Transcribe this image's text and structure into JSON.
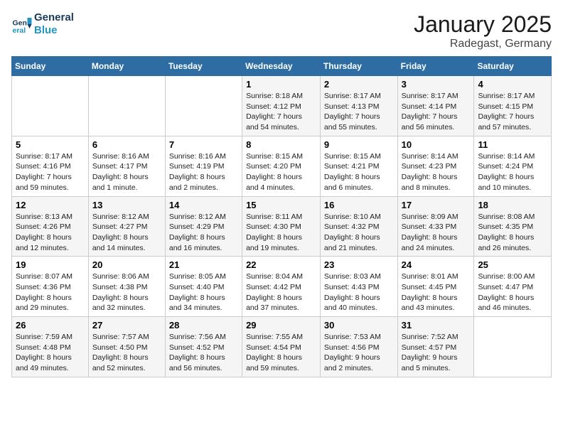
{
  "header": {
    "logo_line1": "General",
    "logo_line2": "Blue",
    "title": "January 2025",
    "subtitle": "Radegast, Germany"
  },
  "days_of_week": [
    "Sunday",
    "Monday",
    "Tuesday",
    "Wednesday",
    "Thursday",
    "Friday",
    "Saturday"
  ],
  "weeks": [
    [
      {
        "day": "",
        "info": ""
      },
      {
        "day": "",
        "info": ""
      },
      {
        "day": "",
        "info": ""
      },
      {
        "day": "1",
        "info": "Sunrise: 8:18 AM\nSunset: 4:12 PM\nDaylight: 7 hours\nand 54 minutes."
      },
      {
        "day": "2",
        "info": "Sunrise: 8:17 AM\nSunset: 4:13 PM\nDaylight: 7 hours\nand 55 minutes."
      },
      {
        "day": "3",
        "info": "Sunrise: 8:17 AM\nSunset: 4:14 PM\nDaylight: 7 hours\nand 56 minutes."
      },
      {
        "day": "4",
        "info": "Sunrise: 8:17 AM\nSunset: 4:15 PM\nDaylight: 7 hours\nand 57 minutes."
      }
    ],
    [
      {
        "day": "5",
        "info": "Sunrise: 8:17 AM\nSunset: 4:16 PM\nDaylight: 7 hours\nand 59 minutes."
      },
      {
        "day": "6",
        "info": "Sunrise: 8:16 AM\nSunset: 4:17 PM\nDaylight: 8 hours\nand 1 minute."
      },
      {
        "day": "7",
        "info": "Sunrise: 8:16 AM\nSunset: 4:19 PM\nDaylight: 8 hours\nand 2 minutes."
      },
      {
        "day": "8",
        "info": "Sunrise: 8:15 AM\nSunset: 4:20 PM\nDaylight: 8 hours\nand 4 minutes."
      },
      {
        "day": "9",
        "info": "Sunrise: 8:15 AM\nSunset: 4:21 PM\nDaylight: 8 hours\nand 6 minutes."
      },
      {
        "day": "10",
        "info": "Sunrise: 8:14 AM\nSunset: 4:23 PM\nDaylight: 8 hours\nand 8 minutes."
      },
      {
        "day": "11",
        "info": "Sunrise: 8:14 AM\nSunset: 4:24 PM\nDaylight: 8 hours\nand 10 minutes."
      }
    ],
    [
      {
        "day": "12",
        "info": "Sunrise: 8:13 AM\nSunset: 4:26 PM\nDaylight: 8 hours\nand 12 minutes."
      },
      {
        "day": "13",
        "info": "Sunrise: 8:12 AM\nSunset: 4:27 PM\nDaylight: 8 hours\nand 14 minutes."
      },
      {
        "day": "14",
        "info": "Sunrise: 8:12 AM\nSunset: 4:29 PM\nDaylight: 8 hours\nand 16 minutes."
      },
      {
        "day": "15",
        "info": "Sunrise: 8:11 AM\nSunset: 4:30 PM\nDaylight: 8 hours\nand 19 minutes."
      },
      {
        "day": "16",
        "info": "Sunrise: 8:10 AM\nSunset: 4:32 PM\nDaylight: 8 hours\nand 21 minutes."
      },
      {
        "day": "17",
        "info": "Sunrise: 8:09 AM\nSunset: 4:33 PM\nDaylight: 8 hours\nand 24 minutes."
      },
      {
        "day": "18",
        "info": "Sunrise: 8:08 AM\nSunset: 4:35 PM\nDaylight: 8 hours\nand 26 minutes."
      }
    ],
    [
      {
        "day": "19",
        "info": "Sunrise: 8:07 AM\nSunset: 4:36 PM\nDaylight: 8 hours\nand 29 minutes."
      },
      {
        "day": "20",
        "info": "Sunrise: 8:06 AM\nSunset: 4:38 PM\nDaylight: 8 hours\nand 32 minutes."
      },
      {
        "day": "21",
        "info": "Sunrise: 8:05 AM\nSunset: 4:40 PM\nDaylight: 8 hours\nand 34 minutes."
      },
      {
        "day": "22",
        "info": "Sunrise: 8:04 AM\nSunset: 4:42 PM\nDaylight: 8 hours\nand 37 minutes."
      },
      {
        "day": "23",
        "info": "Sunrise: 8:03 AM\nSunset: 4:43 PM\nDaylight: 8 hours\nand 40 minutes."
      },
      {
        "day": "24",
        "info": "Sunrise: 8:01 AM\nSunset: 4:45 PM\nDaylight: 8 hours\nand 43 minutes."
      },
      {
        "day": "25",
        "info": "Sunrise: 8:00 AM\nSunset: 4:47 PM\nDaylight: 8 hours\nand 46 minutes."
      }
    ],
    [
      {
        "day": "26",
        "info": "Sunrise: 7:59 AM\nSunset: 4:48 PM\nDaylight: 8 hours\nand 49 minutes."
      },
      {
        "day": "27",
        "info": "Sunrise: 7:57 AM\nSunset: 4:50 PM\nDaylight: 8 hours\nand 52 minutes."
      },
      {
        "day": "28",
        "info": "Sunrise: 7:56 AM\nSunset: 4:52 PM\nDaylight: 8 hours\nand 56 minutes."
      },
      {
        "day": "29",
        "info": "Sunrise: 7:55 AM\nSunset: 4:54 PM\nDaylight: 8 hours\nand 59 minutes."
      },
      {
        "day": "30",
        "info": "Sunrise: 7:53 AM\nSunset: 4:56 PM\nDaylight: 9 hours\nand 2 minutes."
      },
      {
        "day": "31",
        "info": "Sunrise: 7:52 AM\nSunset: 4:57 PM\nDaylight: 9 hours\nand 5 minutes."
      },
      {
        "day": "",
        "info": ""
      }
    ]
  ]
}
